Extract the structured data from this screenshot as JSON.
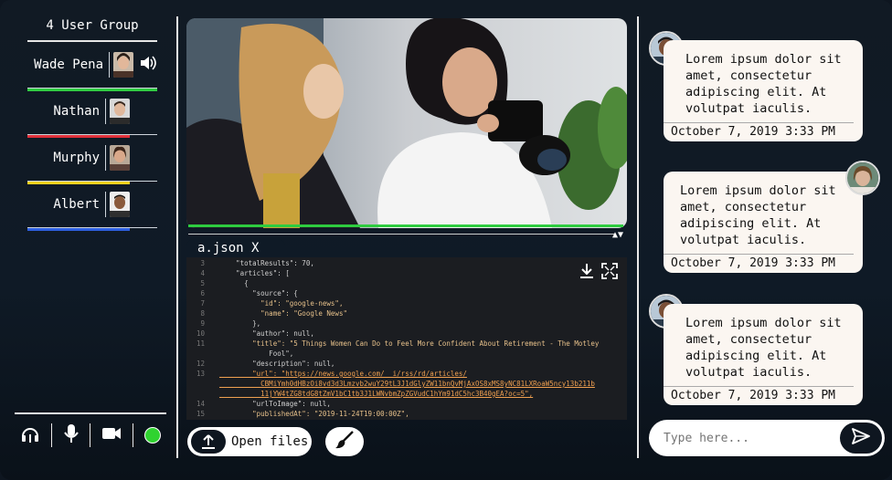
{
  "group": {
    "title": "4 User Group"
  },
  "users": [
    {
      "name": "Wade Pena",
      "color": "#2ecc40",
      "speaking": true
    },
    {
      "name": "Nathan",
      "color": "#e0303a"
    },
    {
      "name": "Murphy",
      "color": "#f2d21e"
    },
    {
      "name": "Albert",
      "color": "#2d5fe0"
    }
  ],
  "icons": {
    "speaker": "speaker-icon",
    "headphones": "headphones-icon",
    "mic": "microphone-icon",
    "video": "video-camera-icon",
    "status": "online-status-dot",
    "download": "download-icon",
    "fullscreen": "fullscreen-icon",
    "upload": "upload-icon",
    "brush": "brush-icon",
    "send": "send-icon"
  },
  "editor": {
    "tab": "a.json X",
    "lines": [
      {
        "n": "3",
        "t": "    \"totalResults\": 70,"
      },
      {
        "n": "4",
        "t": "    \"articles\": ["
      },
      {
        "n": "5",
        "t": "      {"
      },
      {
        "n": "6",
        "t": "        \"source\": {"
      },
      {
        "n": "7",
        "t": "          \"id\": \"google-news\","
      },
      {
        "n": "8",
        "t": "          \"name\": \"Google News\""
      },
      {
        "n": "9",
        "t": "        },"
      },
      {
        "n": "10",
        "t": "        \"author\": null,"
      },
      {
        "n": "11",
        "t": "        \"title\": \"5 Things Women Can Do to Feel More Confident About Retirement - The Motley"
      },
      {
        "n": "",
        "t": "            Fool\","
      },
      {
        "n": "12",
        "t": "        \"description\": null,"
      },
      {
        "n": "13",
        "t": "        \"url\": \"https://news.google.com/__i/rss/rd/articles/"
      },
      {
        "n": "",
        "t": "          CBMiYmh0dHBzOi8vd3d3Lmzvb2wuY29tL3J1dGlyZW11bnQvMjAxOS8xMS8yNC81LXRoaW5ncy13b211b"
      },
      {
        "n": "",
        "t": "          11jYW4tZG8tdG8tZmV1bC1tb3J1LWNvbmZpZGVudC1hYm91dC5hc3B40gEA?oc=5\","
      },
      {
        "n": "14",
        "t": "        \"urlToImage\": null,"
      },
      {
        "n": "15",
        "t": "        \"publishedAt\": \"2019-11-24T19:00:00Z\","
      }
    ]
  },
  "buttons": {
    "open_files": "Open files"
  },
  "chat": {
    "messages": [
      {
        "text": "Lorem ipsum dolor sit amet, consectetur adipiscing elit. At volutpat iaculis.",
        "time": "October 7, 2019 3:33 PM",
        "side": "left"
      },
      {
        "text": "Lorem ipsum dolor sit amet, consectetur adipiscing elit. At volutpat iaculis.",
        "time": "October 7, 2019 3:33 PM",
        "side": "right"
      },
      {
        "text": "Lorem ipsum dolor sit amet, consectetur adipiscing elit. At volutpat iaculis.",
        "time": "October 7, 2019 3:33 PM",
        "side": "left"
      }
    ],
    "input_placeholder": "Type here..."
  }
}
